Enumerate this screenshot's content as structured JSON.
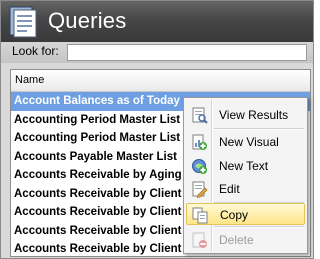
{
  "window": {
    "title": "Queries"
  },
  "search": {
    "label": "Look for:",
    "value": ""
  },
  "grid": {
    "column_header": "Name",
    "rows": [
      "Account Balances as of Today",
      "Accounting Period Master List",
      "Accounting Period Master List",
      "Accounts Payable Master List",
      "Accounts Receivable by Aging",
      "Accounts Receivable by Client",
      "Accounts Receivable by Client",
      "Accounts Receivable by Client",
      "Accounts Receivable by Client"
    ],
    "selected_index": 0
  },
  "context_menu": {
    "items": [
      {
        "label": "View Results",
        "icon": "view-results-icon",
        "enabled": true
      },
      {
        "label": "New Visual",
        "icon": "new-visual-icon",
        "enabled": true
      },
      {
        "label": "New Text",
        "icon": "new-text-icon",
        "enabled": true
      },
      {
        "label": "Edit",
        "icon": "edit-icon",
        "enabled": true
      },
      {
        "label": "Copy",
        "icon": "copy-icon",
        "enabled": true,
        "highlighted": true
      },
      {
        "label": "Delete",
        "icon": "delete-icon",
        "enabled": false
      }
    ]
  },
  "colors": {
    "titlebar": "#474747",
    "selection": "#6f9fe3",
    "menu_highlight": "#ffe68a"
  }
}
